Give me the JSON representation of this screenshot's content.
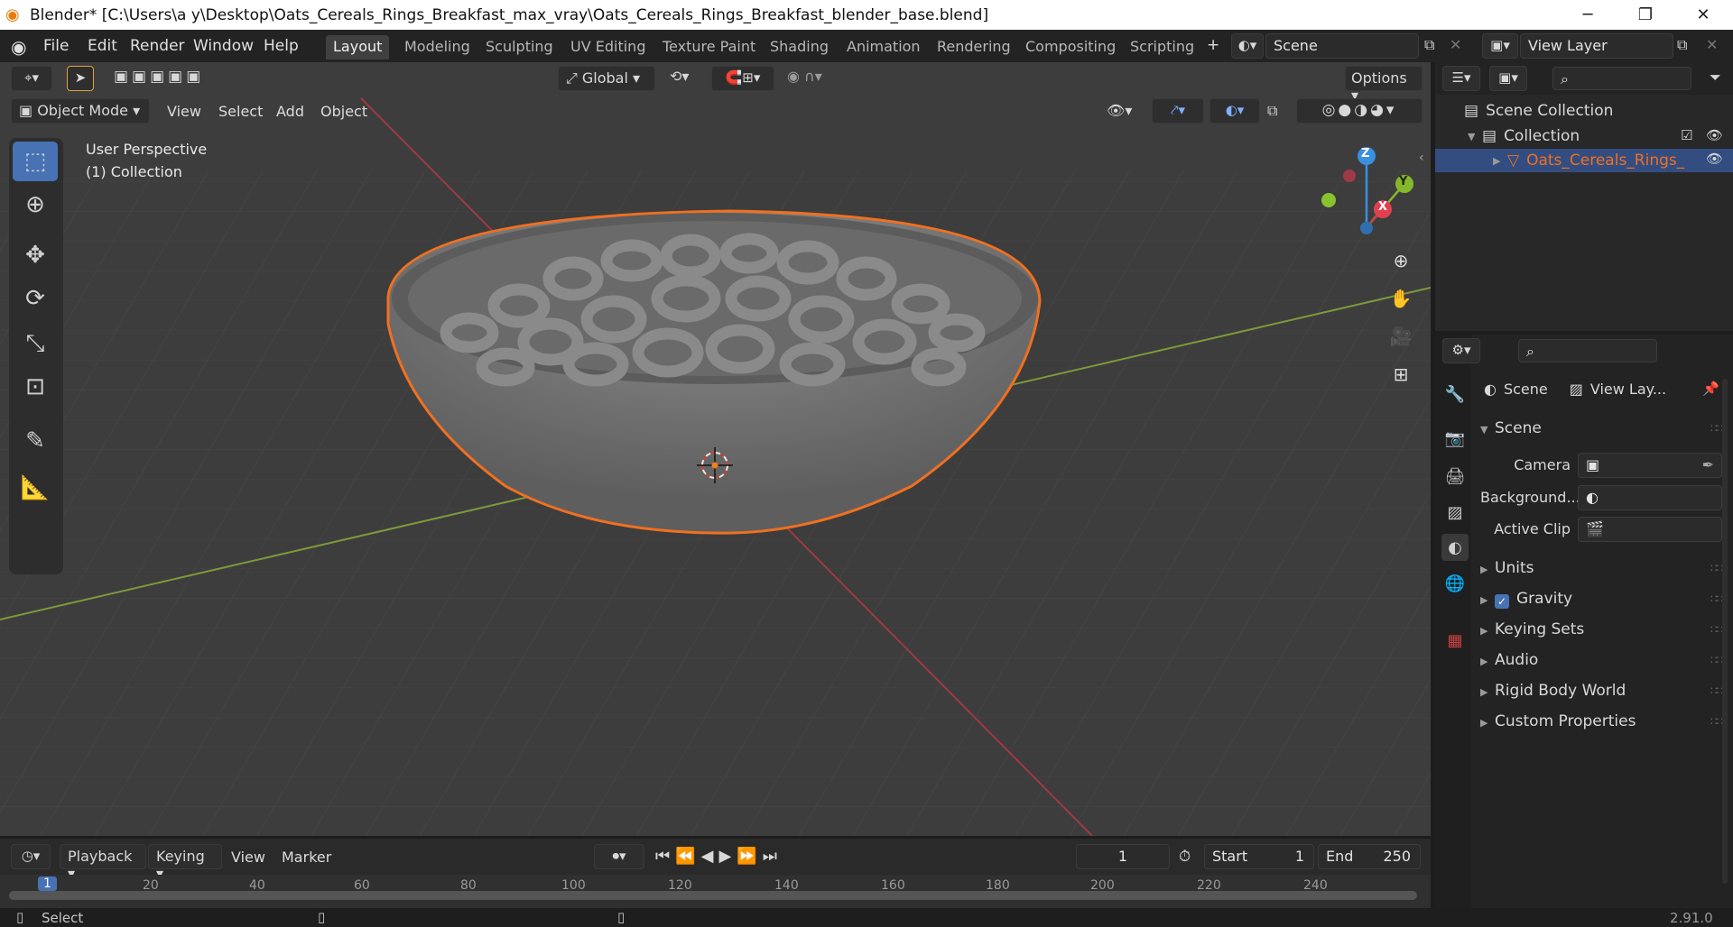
{
  "titlebar": {
    "title": "Blender* [C:\\Users\\a y\\Desktop\\Oats_Cereals_Rings_Breakfast_max_vray\\Oats_Cereals_Rings_Breakfast_blender_base.blend]",
    "icons": [
      "blender-logo-icon",
      "minimize-icon",
      "restore-icon",
      "close-icon"
    ]
  },
  "menubar": {
    "menus": [
      "File",
      "Edit",
      "Render",
      "Window",
      "Help"
    ],
    "workspaces": [
      "Layout",
      "Modeling",
      "Sculpting",
      "UV Editing",
      "Texture Paint",
      "Shading",
      "Animation",
      "Rendering",
      "Compositing",
      "Scripting"
    ],
    "active_workspace": "Layout",
    "add_workspace": "+",
    "scene": "Scene",
    "view_layer": "View Layer"
  },
  "viewport": {
    "transform_orientation": "Global",
    "options_label": "Options",
    "mode": "Object Mode",
    "header_menus": [
      "View",
      "Select",
      "Add",
      "Object"
    ],
    "overlay_text": [
      "User Perspective",
      "(1) Collection"
    ],
    "gizmo_axes": [
      "Z",
      "Y",
      "X"
    ],
    "colors": {
      "x_axis": "#c5404c",
      "y_axis": "#86b82d",
      "z_axis": "#3a8fe0",
      "selection_outline": "#f07020"
    }
  },
  "outliner": {
    "items": [
      {
        "label": "Scene Collection",
        "type": "scene-collection"
      },
      {
        "label": "Collection",
        "type": "collection"
      },
      {
        "label": "Oats_Cereals_Rings_",
        "type": "mesh-object",
        "selected": true
      }
    ]
  },
  "properties": {
    "tabs": [
      "tool-icon",
      "render-icon",
      "output-icon",
      "view-layer-icon",
      "scene-icon",
      "world-icon",
      "texture-icon"
    ],
    "breadcrumb": [
      "Scene",
      "View Lay..."
    ],
    "scene_panel": "Scene",
    "fields": [
      {
        "label": "Camera",
        "value": ""
      },
      {
        "label": "Background...",
        "value": ""
      },
      {
        "label": "Active Clip",
        "value": ""
      }
    ],
    "subpanels": [
      "Units",
      "Gravity",
      "Keying Sets",
      "Audio",
      "Rigid Body World",
      "Custom Properties"
    ],
    "gravity_checked": true
  },
  "timeline": {
    "menus": [
      "Playback",
      "Keying",
      "View",
      "Marker"
    ],
    "current_frame": "1",
    "start_label": "Start",
    "start": "1",
    "end_label": "End",
    "end": "250",
    "ruler": [
      "1",
      "20",
      "40",
      "60",
      "80",
      "100",
      "120",
      "140",
      "160",
      "180",
      "200",
      "220",
      "240"
    ]
  },
  "statusbar": {
    "hint": "Select",
    "version": "2.91.0"
  }
}
